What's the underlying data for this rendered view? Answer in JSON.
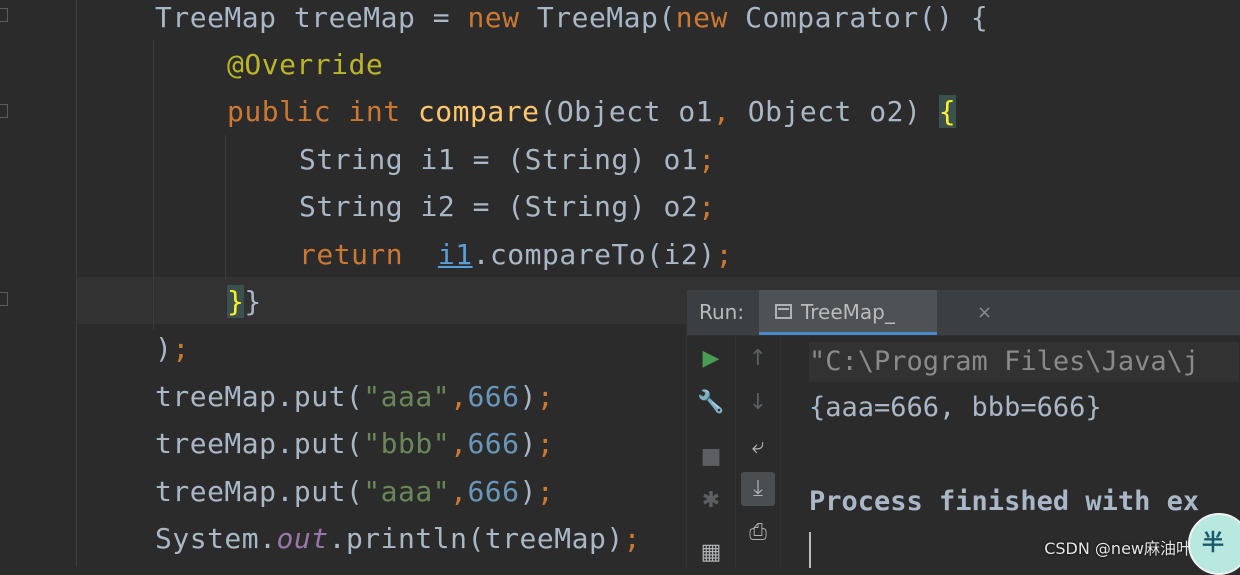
{
  "editor": {
    "lines": [
      [
        {
          "t": "TreeMap treeMap = "
        },
        {
          "t": "new",
          "c": "kw"
        },
        {
          "t": " TreeMap("
        },
        {
          "t": "new",
          "c": "kw"
        },
        {
          "t": " Comparator() {"
        }
      ],
      [
        {
          "t": "@Override",
          "c": "ann"
        }
      ],
      [
        {
          "t": "public",
          "c": "kw"
        },
        {
          "t": " "
        },
        {
          "t": "int",
          "c": "kw"
        },
        {
          "t": " "
        },
        {
          "t": "compare",
          "c": "fn"
        },
        {
          "t": "(Object o1"
        },
        {
          "t": ",",
          "c": "kw"
        },
        {
          "t": " Object o2) "
        },
        {
          "t": "{",
          "c": "brace-match"
        }
      ],
      [
        {
          "t": "String i1 = (String) o1"
        },
        {
          "t": ";",
          "c": "kw"
        }
      ],
      [
        {
          "t": "String i2 = (String) o2"
        },
        {
          "t": ";",
          "c": "kw"
        }
      ],
      [
        {
          "t": "return",
          "c": "kw"
        },
        {
          "t": "  "
        },
        {
          "t": "i1",
          "c": "ul"
        },
        {
          "t": ".compareTo(i2)"
        },
        {
          "t": ";",
          "c": "kw"
        }
      ],
      [
        {
          "t": "}",
          "c": "brace-match"
        },
        {
          "t": "}"
        }
      ],
      [
        {
          "t": ")"
        },
        {
          "t": ";",
          "c": "kw"
        }
      ],
      [
        {
          "t": "treeMap.put("
        },
        {
          "t": "\"aaa\"",
          "c": "str"
        },
        {
          "t": ",",
          "c": "kw"
        },
        {
          "t": "666",
          "c": "num"
        },
        {
          "t": ")"
        },
        {
          "t": ";",
          "c": "kw"
        }
      ],
      [
        {
          "t": "treeMap.put("
        },
        {
          "t": "\"bbb\"",
          "c": "str"
        },
        {
          "t": ",",
          "c": "kw"
        },
        {
          "t": "666",
          "c": "num"
        },
        {
          "t": ")"
        },
        {
          "t": ";",
          "c": "kw"
        }
      ],
      [
        {
          "t": "treeMap.put("
        },
        {
          "t": "\"aaa\"",
          "c": "str"
        },
        {
          "t": ",",
          "c": "kw"
        },
        {
          "t": "666",
          "c": "num"
        },
        {
          "t": ")"
        },
        {
          "t": ";",
          "c": "kw"
        }
      ],
      [
        {
          "t": "System."
        },
        {
          "t": "out",
          "c": "fld"
        },
        {
          "t": ".println(treeMap)"
        },
        {
          "t": ";",
          "c": "kw"
        }
      ]
    ]
  },
  "run": {
    "label": "Run:",
    "tab_title": "TreeMap_",
    "tab_close": "×",
    "console": {
      "command": "\"C:\\Program Files\\Java\\j",
      "output": "{aaa=666, bbb=666}",
      "status": "Process finished with ex"
    }
  },
  "icons": {
    "rerun": "play-icon",
    "settings": "wrench-icon",
    "stop": "stop-icon",
    "debug": "bug-icon",
    "layout": "layout-icon",
    "up": "arrow-up-icon",
    "down": "arrow-down-icon",
    "soft_wrap": "soft-wrap-icon",
    "scroll_end": "scroll-to-end-icon",
    "print": "print-icon"
  },
  "watermark": {
    "text": "CSDN @new麻油叶先生",
    "badge": "半"
  },
  "colors": {
    "background": "#2b2b2b",
    "keyword": "#cc7832",
    "string": "#6a8759",
    "number": "#6897bb",
    "function": "#ffc66d",
    "annotation": "#bbb529",
    "tab_accent": "#4a88c7"
  }
}
